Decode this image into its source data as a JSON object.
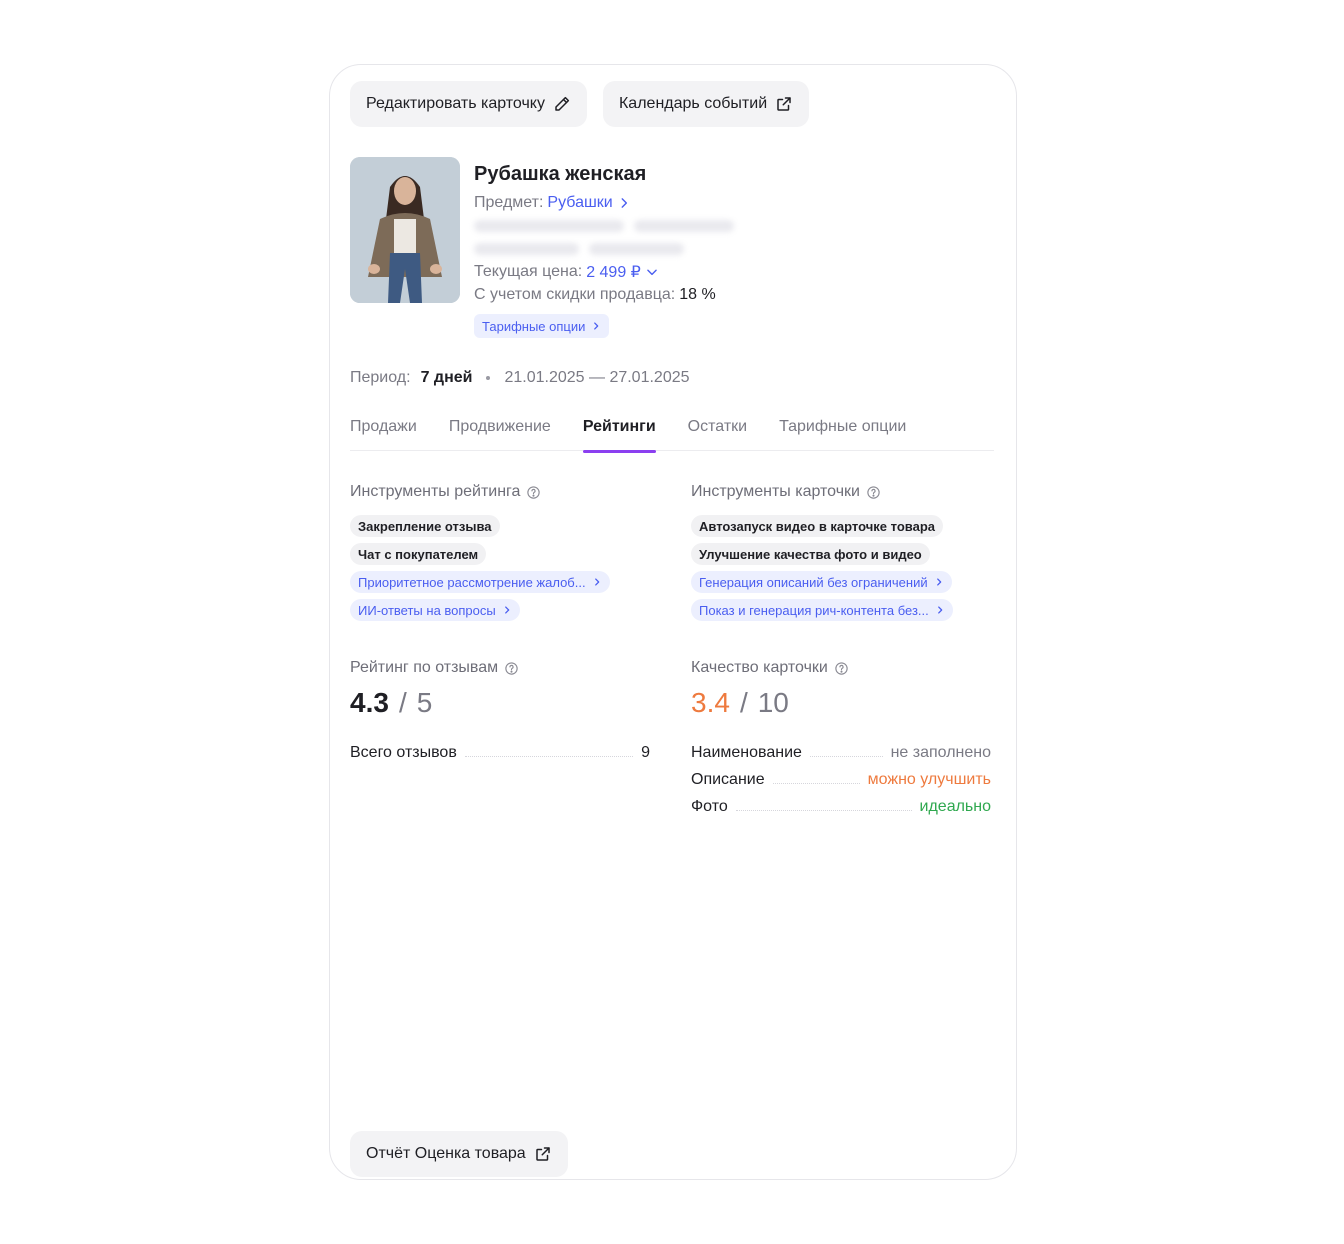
{
  "top_actions": {
    "edit_label": "Редактировать карточку",
    "calendar_label": "Календарь событий"
  },
  "product": {
    "title": "Рубашка женская",
    "subject_label": "Предмет:",
    "subject_value": "Рубашки",
    "price_label": "Текущая цена:",
    "price_value": "2 499 ₽",
    "discount_label": "С учетом скидки продавца:",
    "discount_value": "18 %",
    "tariff_badge": "Тарифные опции"
  },
  "period": {
    "label": "Период:",
    "value": "7 дней",
    "range": "21.01.2025 — 27.01.2025"
  },
  "tabs": [
    {
      "label": "Продажи"
    },
    {
      "label": "Продвижение"
    },
    {
      "label": "Рейтинги"
    },
    {
      "label": "Остатки"
    },
    {
      "label": "Тарифные опции"
    }
  ],
  "rating_tools": {
    "title": "Инструменты рейтинга",
    "chips": [
      {
        "label": "Закрепление отзыва"
      },
      {
        "label": "Чат с покупателем"
      },
      {
        "label": "Приоритетное рассмотрение жалоб..."
      },
      {
        "label": "ИИ-ответы на вопросы"
      }
    ]
  },
  "card_tools": {
    "title": "Инструменты карточки",
    "chips": [
      {
        "label": "Автозапуск видео в карточке товара"
      },
      {
        "label": "Улучшение качества фото и видео"
      },
      {
        "label": "Генерация описаний без ограничений"
      },
      {
        "label": "Показ и генерация рич-контента без..."
      }
    ]
  },
  "review_rating": {
    "title": "Рейтинг по отзывам",
    "score": "4.3",
    "separator": "/",
    "max": "5",
    "rows": [
      {
        "label": "Всего отзывов",
        "value": "9"
      }
    ]
  },
  "card_quality": {
    "title": "Качество карточки",
    "score": "3.4",
    "separator": "/",
    "max": "10",
    "rows": [
      {
        "label": "Наименование",
        "value": "не заполнено"
      },
      {
        "label": "Описание",
        "value": "можно улучшить"
      },
      {
        "label": "Фото",
        "value": "идеально"
      }
    ]
  },
  "bottom": {
    "report_label": "Отчёт Оценка товара"
  },
  "colors": {
    "accent_link": "#4a5ef0",
    "tab_underline": "#8b3ff0",
    "orange": "#ee7a3e",
    "green": "#2fa84f"
  }
}
